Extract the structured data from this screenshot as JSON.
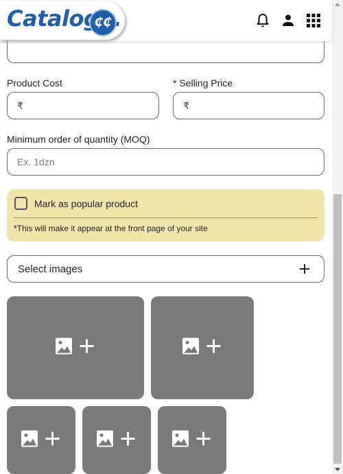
{
  "header": {
    "logo_text": "Cataloge.",
    "logo_badge": "₵₵",
    "icons": [
      "bell-icon",
      "person-icon",
      "apps-grid-icon"
    ]
  },
  "form": {
    "product_cost": {
      "label": "Product Cost",
      "currency": "₹",
      "value": ""
    },
    "selling_price": {
      "label": "* Selling Price",
      "currency": "₹",
      "value": ""
    },
    "moq": {
      "label": "Minimum order of quantity (MOQ)",
      "placeholder": "Ex. 1dzn",
      "value": ""
    },
    "popular": {
      "label": "Mark as popular product",
      "checked": false,
      "note": "*This will make it appear at the front page of your site"
    },
    "select_images": {
      "label": "Select images",
      "icon": "plus-icon"
    },
    "image_slots": [
      {
        "icon": "add-image-icon"
      },
      {
        "icon": "add-image-icon"
      },
      {
        "icon": "add-image-icon"
      },
      {
        "icon": "add-image-icon"
      },
      {
        "icon": "add-image-icon"
      }
    ]
  },
  "colors": {
    "brand": "#1f5fa8",
    "popular_bg": "#f1e5ac",
    "image_slot_bg": "#7a7a7a"
  }
}
